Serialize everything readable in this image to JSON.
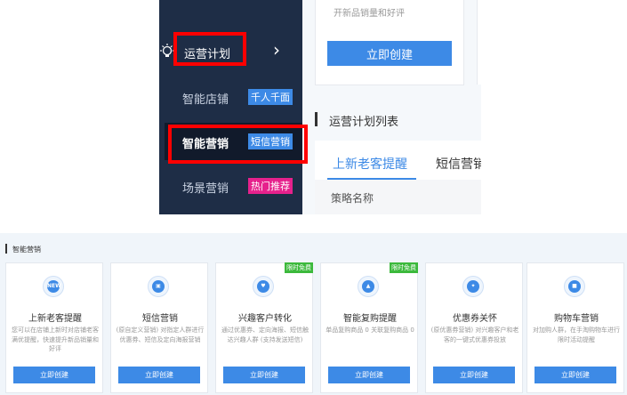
{
  "sidebar": {
    "title": "运营计划",
    "arrow": "›",
    "items": [
      {
        "label": "智能店铺",
        "tag": "千人千面",
        "tag_color": "#3d8ae6"
      },
      {
        "label": "智能营销",
        "tag": "短信营销",
        "tag_color": "#3d8ae6"
      },
      {
        "label": "场景营销",
        "tag": "热门推荐",
        "tag_color": "#e6218c"
      }
    ]
  },
  "top_card": {
    "desc": "开新品销量和好评",
    "button": "立即创建"
  },
  "list": {
    "title": "运营计划列表",
    "tabs": [
      "上新老客提醒",
      "短信营销"
    ],
    "column": "策略名称"
  },
  "section": {
    "title": "智能营销",
    "cards": [
      {
        "name": "上新老客提醒",
        "desc": "您可以在店铺上新时对店铺老客满优提醒，快速提升新品销量和好评",
        "button": "立即创建",
        "badge": "",
        "icon": "new-icon",
        "icon_text": "NEW"
      },
      {
        "name": "短信营销",
        "desc": "(原自定义营销) 对指定人群进行优惠券、短信及定向海报营销",
        "button": "立即创建",
        "badge": "",
        "icon": "gift-icon",
        "icon_text": "▣"
      },
      {
        "name": "兴趣客户转化",
        "desc": "通过优惠券、定向海报、短信触达兴趣人群 (支持发送短信)",
        "button": "立即创建",
        "badge": "限时免费",
        "icon": "heart-icon",
        "icon_text": "♥"
      },
      {
        "name": "智能复购提醒",
        "desc": "单品复购商品 0 关联复购商品 0",
        "button": "立即创建",
        "badge": "限时免费",
        "icon": "bell-icon",
        "icon_text": "▲"
      },
      {
        "name": "优惠券关怀",
        "desc": "(原优惠券营销) 对兴趣客户和老客的一键式优惠券投放",
        "button": "立即创建",
        "badge": "",
        "icon": "coupon-icon",
        "icon_text": "✦"
      },
      {
        "name": "购物车营销",
        "desc": "对加购人群，在手淘购物车进行限时活动提醒",
        "button": "立即创建",
        "badge": "",
        "icon": "cart-icon",
        "icon_text": "■"
      }
    ]
  },
  "colors": {
    "accent": "#3d8ae6",
    "sidebar_bg": "#1e2d46",
    "highlight": "#ff0000",
    "badge": "#3cb93c"
  }
}
